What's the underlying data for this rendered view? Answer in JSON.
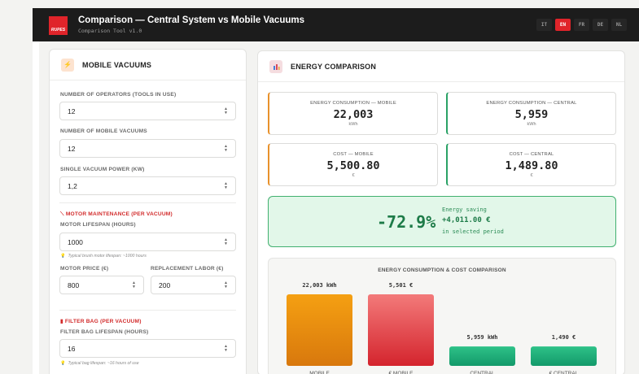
{
  "header": {
    "logo_text": "RUPES",
    "title": "Comparison — Central System vs Mobile Vacuums",
    "subtitle": "Comparison Tool v1.0",
    "languages": [
      {
        "code": "IT",
        "active": false
      },
      {
        "code": "EN",
        "active": true
      },
      {
        "code": "FR",
        "active": false
      },
      {
        "code": "DE",
        "active": false
      },
      {
        "code": "NL",
        "active": false
      }
    ]
  },
  "left_panel": {
    "icon": "lightning-icon",
    "title": "MOBILE VACUUMS",
    "operators_label": "NUMBER OF OPERATORS (TOOLS IN USE)",
    "operators_value": "12",
    "vacuums_label": "NUMBER OF MOBILE VACUUMS",
    "vacuums_value": "12",
    "power_label": "SINGLE VACUUM POWER (KW)",
    "power_value": "1,2",
    "motor_section": "MOTOR MAINTENANCE (PER VACUUM)",
    "motor_lifespan_label": "MOTOR LIFESPAN (HOURS)",
    "motor_lifespan_value": "1000",
    "motor_hint": "Typical brush motor lifespan: ~1000 hours",
    "motor_price_label": "MOTOR PRICE (€)",
    "motor_price_value": "800",
    "labor_label": "REPLACEMENT LABOR (€)",
    "labor_value": "200",
    "filter_section": "FILTER BAG (PER VACUUM)",
    "filter_lifespan_label": "FILTER BAG LIFESPAN (HOURS)",
    "filter_lifespan_value": "16",
    "filter_hint": "Typical bag lifespan: ~16 hours of use"
  },
  "right_panel": {
    "icon": "bar-chart-icon",
    "title": "ENERGY COMPARISON",
    "cards": {
      "energy_mobile": {
        "label": "ENERGY CONSUMPTION — MOBILE",
        "value": "22,003",
        "unit": "kWh"
      },
      "energy_central": {
        "label": "ENERGY CONSUMPTION — CENTRAL",
        "value": "5,959",
        "unit": "kWh"
      },
      "cost_mobile": {
        "label": "COST — MOBILE",
        "value": "5,500.80",
        "unit": "€"
      },
      "cost_central": {
        "label": "COST — CENTRAL",
        "value": "1,489.80",
        "unit": "€"
      }
    },
    "saving": {
      "percent": "-72.9%",
      "label": "Energy saving",
      "value": "+4,011.00 €",
      "period": "in selected period"
    }
  },
  "chart_data": {
    "type": "bar",
    "title": "ENERGY CONSUMPTION & COST COMPARISON",
    "categories": [
      "MOBILE",
      "€ MOBILE",
      "CENTRAL",
      "€ CENTRAL"
    ],
    "values": [
      22003,
      5501,
      5959,
      1490
    ],
    "value_labels": [
      "22,003 kWh",
      "5,501 €",
      "5,959 kWh",
      "1,490 €"
    ],
    "colors": [
      [
        "#f5a012",
        "#d8780d"
      ],
      [
        "#f37a7a",
        "#d4242d"
      ],
      [
        "#2ec288",
        "#13996a"
      ],
      [
        "#2ec288",
        "#13996a"
      ]
    ]
  }
}
